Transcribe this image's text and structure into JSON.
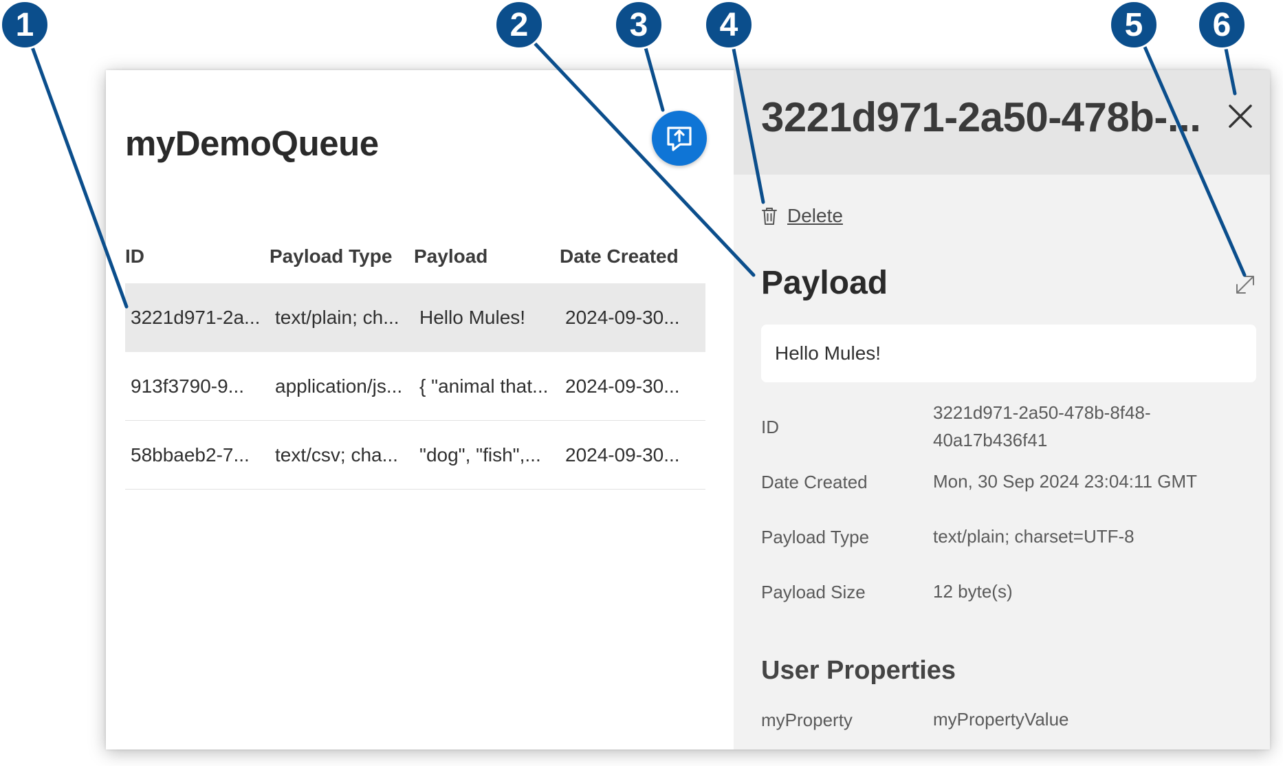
{
  "queue": {
    "title": "myDemoQueue"
  },
  "table": {
    "headers": [
      "ID",
      "Payload Type",
      "Payload",
      "Date Created"
    ],
    "rows": [
      [
        "3221d971-2a...",
        "text/plain; ch...",
        "Hello Mules!",
        "2024-09-30..."
      ],
      [
        "913f3790-9...",
        "application/js...",
        "{ \"animal that...",
        "2024-09-30..."
      ],
      [
        "58bbaeb2-7...",
        "text/csv; cha...",
        "\"dog\", \"fish\",...",
        "2024-09-30..."
      ]
    ]
  },
  "detail": {
    "title": "3221d971-2a50-478b-...",
    "delete_label": "Delete",
    "payload_heading": "Payload",
    "payload_value": "Hello Mules!",
    "properties": [
      {
        "label": "ID",
        "value": "3221d971-2a50-478b-8f48-40a17b436f41"
      },
      {
        "label": "Date Created",
        "value": "Mon, 30 Sep 2024 23:04:11 GMT"
      },
      {
        "label": "Payload Type",
        "value": "text/plain; charset=UTF-8"
      },
      {
        "label": "Payload Size",
        "value": "12 byte(s)"
      }
    ],
    "user_properties_heading": "User Properties",
    "user_properties": [
      {
        "label": "myProperty",
        "value": "myPropertyValue"
      }
    ]
  },
  "callouts": [
    "1",
    "2",
    "3",
    "4",
    "5",
    "6"
  ],
  "colors": {
    "accent": "#0f75d6",
    "callout": "#0b4e8c",
    "selected_row": "#e9e9e9",
    "detail_bg": "#f2f2f2"
  },
  "icons": {
    "publish": "message-upload-icon",
    "close": "close-icon",
    "delete": "trash-icon",
    "expand": "expand-icon"
  }
}
